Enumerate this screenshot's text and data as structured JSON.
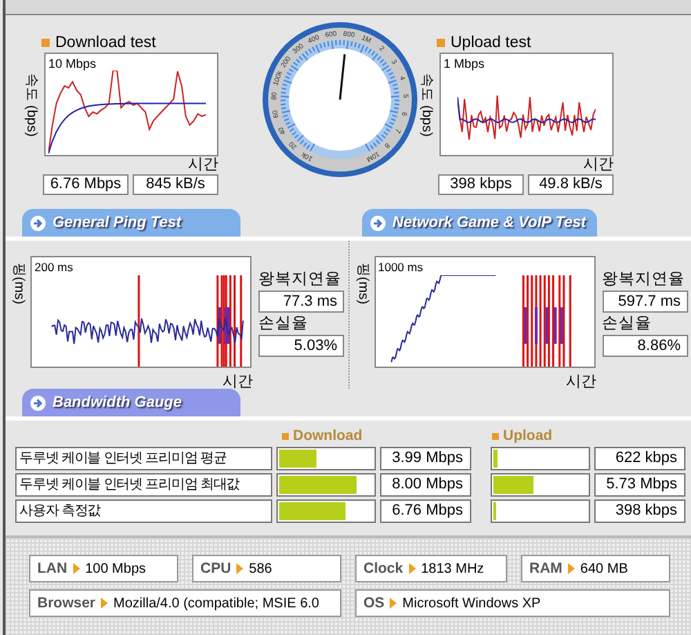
{
  "download_test": {
    "title": "Download test",
    "y_axis_label": "속도 (bps)",
    "scale_label": "10 Mbps",
    "x_axis_label": "시간",
    "speed": "6.76 Mbps",
    "rate": "845 kB/s"
  },
  "speed_gauge": {
    "tick_labels": [
      "10k",
      "20",
      "40",
      "60",
      "80",
      "100k",
      "200",
      "300",
      "400",
      "600",
      "800",
      "1M",
      "2",
      "3",
      "4",
      "5",
      "6",
      "7",
      "8",
      "10M"
    ]
  },
  "upload_test": {
    "title": "Upload test",
    "y_axis_label": "속도 (bps)",
    "scale_label": "1 Mbps",
    "x_axis_label": "시간",
    "speed": "398 kbps",
    "rate": "49.8 kB/s"
  },
  "section_tabs": [
    {
      "label": "General Ping Test"
    },
    {
      "label": "Network Game & VoIP Test"
    }
  ],
  "ping_tests": [
    {
      "y_axis_label": "핑(ms)",
      "scale_label": "200 ms",
      "x_axis_label": "시간",
      "latency_label": "왕복지연율",
      "latency": "77.3 ms",
      "loss_label": "손실율",
      "loss": "5.03%"
    },
    {
      "y_axis_label": "핑(ms)",
      "scale_label": "1000 ms",
      "x_axis_label": "시간",
      "latency_label": "왕복지연율",
      "latency": "597.7 ms",
      "loss_label": "손실율",
      "loss": "8.86%"
    }
  ],
  "bandwidth_tab": {
    "label": "Bandwidth Gauge"
  },
  "bandwidth": {
    "columns": [
      {
        "label": "Download"
      },
      {
        "label": "Upload"
      }
    ],
    "rows": [
      {
        "label": "두루넷 케이블 인터넷 프리미엄 평균",
        "download": {
          "level": 0.4,
          "reading": "3.99 Mbps"
        },
        "upload": {
          "level": 0.04,
          "reading": "622 kbps"
        }
      },
      {
        "label": "두루넷 케이블 인터넷 프리미엄 최대값",
        "download": {
          "level": 0.82,
          "reading": "8.00 Mbps"
        },
        "upload": {
          "level": 0.42,
          "reading": "5.73 Mbps"
        }
      },
      {
        "label": "사용자 측정값",
        "download": {
          "level": 0.7,
          "reading": "6.76 Mbps"
        },
        "upload": {
          "level": 0.03,
          "reading": "398 kbps"
        }
      }
    ]
  },
  "system_info": [
    {
      "label": "LAN",
      "value": "100 Mbps"
    },
    {
      "label": "CPU",
      "value": "586"
    },
    {
      "label": "Clock",
      "value": "1813 MHz"
    },
    {
      "label": "RAM",
      "value": "640 MB"
    },
    {
      "label": "Browser",
      "value": "Mozilla/4.0 (compatible; MSIE 6.0"
    },
    {
      "label": "OS",
      "value": "Microsoft Windows XP"
    }
  ]
}
